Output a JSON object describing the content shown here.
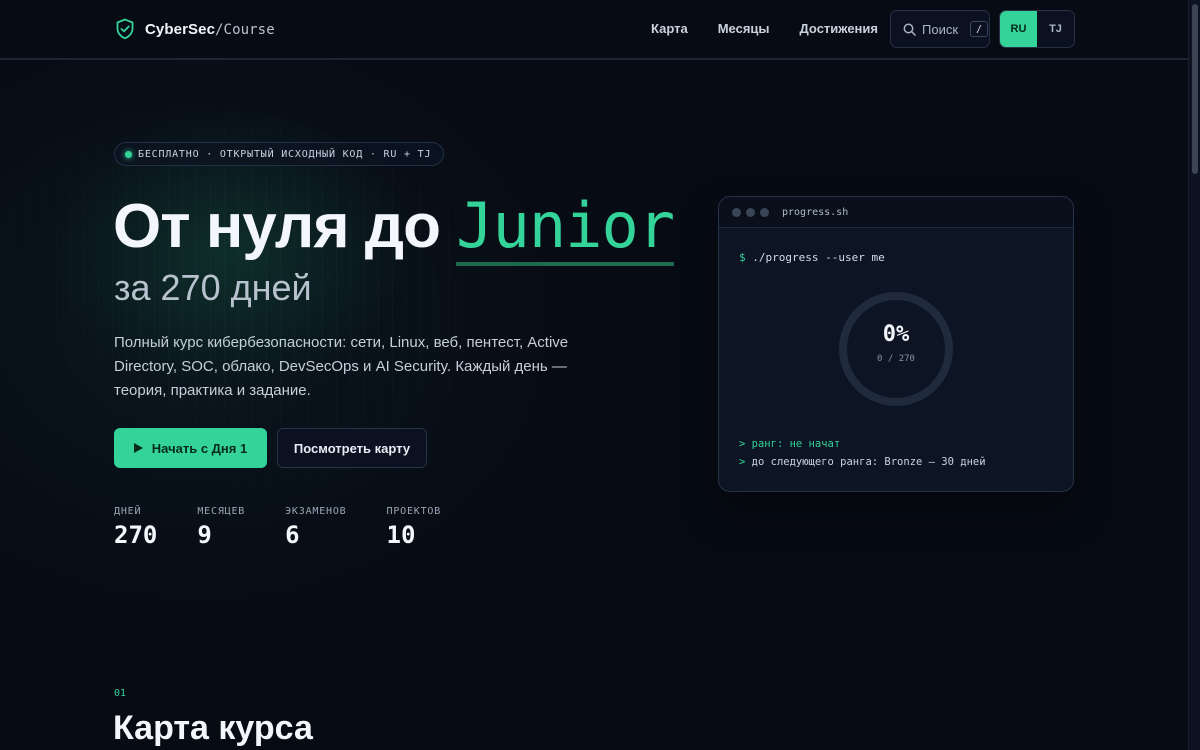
{
  "header": {
    "brand": "CyberSec",
    "brand_suffix": "/Course",
    "nav": [
      {
        "label": "Карта"
      },
      {
        "label": "Месяцы"
      },
      {
        "label": "Достижения"
      }
    ],
    "search": {
      "label": "Поиск",
      "shortcut": "/"
    },
    "languages": [
      {
        "label": "RU",
        "active": true
      },
      {
        "label": "TJ",
        "active": false
      }
    ]
  },
  "hero": {
    "badge": "БЕСПЛАТНО · ОТКРЫТЫЙ ИСХОДНЫЙ КОД · RU + TJ",
    "title_prefix": "От нуля до ",
    "title_accent": "Junior",
    "subtitle": "за 270 дней",
    "description": "Полный курс кибербезопасности: сети, Linux, веб, пентест, Active Directory, SOC, облако, DevSecOps и AI Security. Каждый день — теория, практика и задание.",
    "primary_button": "Начать с Дня 1",
    "secondary_button": "Посмотреть карту",
    "stats": [
      {
        "label": "ДНЕЙ",
        "value": "270"
      },
      {
        "label": "МЕСЯЦЕВ",
        "value": "9"
      },
      {
        "label": "ЭКЗАМЕНОВ",
        "value": "6"
      },
      {
        "label": "ПРОЕКТОВ",
        "value": "10"
      }
    ]
  },
  "terminal": {
    "title": "progress.sh",
    "prompt": "$",
    "command": "./progress --user me",
    "percent": "0%",
    "progress_text": "0 / 270",
    "progress_fraction": 0,
    "line1_prefix": ">",
    "line1": "ранг: не начат",
    "line2_prefix": ">",
    "line2": "до следующего ранга: Bronze — 30 дней"
  },
  "section": {
    "number": "01",
    "title": "Карта курса"
  },
  "colors": {
    "background": "#070b14",
    "accent": "#34d399",
    "card": "#0d1424",
    "border": "#263247"
  }
}
